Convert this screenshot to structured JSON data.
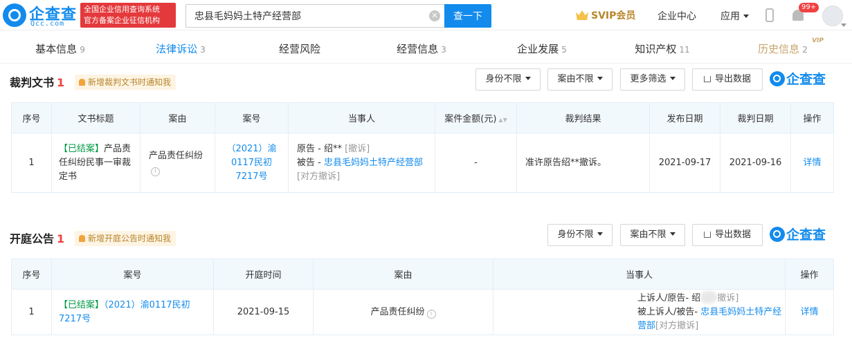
{
  "header": {
    "logo_name": "企查查",
    "logo_domain": "Qcc.com",
    "slogan_line1": "全国企业信用查询系统",
    "slogan_line2": "官方备案企业征信机构",
    "search_value": "忠县毛妈妈土特产经营部",
    "clear_symbol": "✕",
    "search_button": "查一下",
    "svip": "SVIP会员",
    "enterprise_center": "企业中心",
    "apps": "应用",
    "badge": "99+"
  },
  "tabs": [
    {
      "label": "基本信息",
      "count": "9"
    },
    {
      "label": "法律诉讼",
      "count": "3"
    },
    {
      "label": "经营风险",
      "count": ""
    },
    {
      "label": "经营信息",
      "count": "3"
    },
    {
      "label": "企业发展",
      "count": "5"
    },
    {
      "label": "知识产权",
      "count": "11"
    },
    {
      "label": "历史信息",
      "count": "2",
      "vip": "VIP"
    }
  ],
  "judgment": {
    "title": "裁判文书",
    "count": "1",
    "notify": "新增裁判文书时通知我",
    "filters": [
      "身份不限",
      "案由不限",
      "更多筛选"
    ],
    "export": "导出数据",
    "brand": "企查查",
    "headers": [
      "序号",
      "文书标题",
      "案由",
      "案号",
      "当事人",
      "案件金额(元)",
      "裁判结果",
      "发布日期",
      "裁判日期",
      "操作"
    ],
    "sort_symbol": "▲▼",
    "info_symbol": "i",
    "row": {
      "index": "1",
      "status": "【已结案】",
      "title_rest": "产品责任纠纷民事一审裁定书",
      "cause": "产品责任纠纷",
      "case_no": "（2021）渝0117民初7217号",
      "plaintiff_label": "原告 - 绍**",
      "plaintiff_tag": "[撤诉]",
      "defendant_label": "被告 - ",
      "defendant_name": "忠县毛妈妈土特产经营部",
      "defendant_tag": "[对方撤诉]",
      "amount": "-",
      "result": "准许原告绍**撤诉。",
      "publish_date": "2021-09-17",
      "judge_date": "2021-09-16",
      "action": "详情"
    }
  },
  "hearing": {
    "title": "开庭公告",
    "count": "1",
    "notify": "新增开庭公告时通知我",
    "filters": [
      "身份不限",
      "案由不限"
    ],
    "export": "导出数据",
    "brand": "企查查",
    "headers": [
      "序号",
      "案号",
      "开庭时间",
      "案由",
      "当事人",
      "操作"
    ],
    "info_symbol": "i",
    "row": {
      "index": "1",
      "status": "【已结案】",
      "case_no": "（2021）渝0117民初7217号",
      "time": "2021-09-15",
      "cause": "产品责任纠纷",
      "appellant_label": "上诉人/原告- 绍",
      "appellant_tag": "撤诉]",
      "appellee_label": "被上诉人/被告- ",
      "appellee_name": "忠县毛妈妈土特产经营部",
      "appellee_tag": "[对方撤诉]",
      "action": "详情"
    }
  }
}
